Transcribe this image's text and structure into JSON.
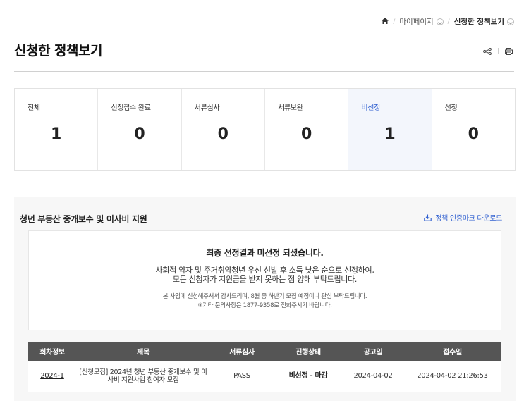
{
  "breadcrumb": {
    "items": [
      "마이페이지",
      "신청한 정책보기"
    ]
  },
  "page": {
    "title": "신청한 정책보기"
  },
  "status_summary": [
    {
      "label": "전체",
      "count": "1"
    },
    {
      "label": "신청접수 완료",
      "count": "0"
    },
    {
      "label": "서류심사",
      "count": "0"
    },
    {
      "label": "서류보완",
      "count": "0"
    },
    {
      "label": "비선정",
      "count": "1"
    },
    {
      "label": "선정",
      "count": "0"
    }
  ],
  "policy": {
    "title": "청년 부동산 중개보수 및 이사비 지원",
    "download_label": "정책 인증마크 다운로드",
    "result_heading": "최종 선정결과 미선정 되셨습니다.",
    "result_line1": "사회적 약자 및 주거취약청년 우선 선발 후 소득 낮은 순으로 선정하여,",
    "result_line2": "모든 신청자가 지원금을 받지 못하는 점 양해 부탁드립니다.",
    "note_line1": "본 사업에 신청해주셔서 감사드리며, 8월 중 하반기 모집 예정이니 관심 부탁드립니다.",
    "note_line2": "※기타 문의사항은 1877-9358로 전화주시기 바랍니다."
  },
  "history_table": {
    "headers": [
      "회차정보",
      "제목",
      "서류심사",
      "진행상태",
      "공고일",
      "접수일"
    ],
    "rows": [
      {
        "round": "2024-1",
        "title": "[신청모집] 2024년 청년 부동산 중개보수 및 이사비 지원사업 참여자 모집",
        "doc_review": "PASS",
        "status": "비선정 - 마감",
        "notice_date": "2024-04-02",
        "received_date": "2024-04-02 21:26:53"
      }
    ]
  },
  "colors": {
    "accent": "#2f5fd0",
    "active_bg": "#f3f6fc",
    "table_header": "#555555"
  }
}
